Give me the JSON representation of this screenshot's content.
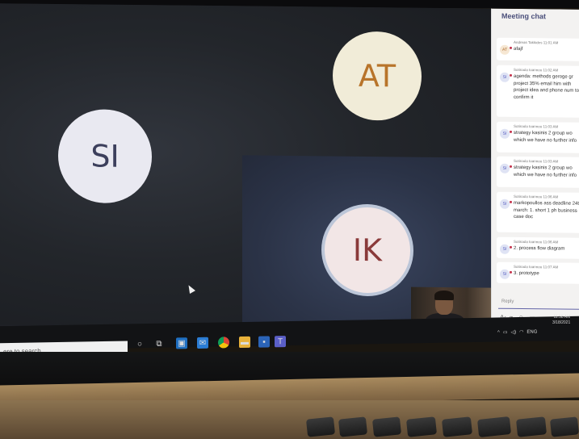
{
  "meeting": {
    "participants": [
      {
        "initials": "SI"
      },
      {
        "initials": "AT"
      },
      {
        "initials": "IK"
      }
    ]
  },
  "chat": {
    "title": "Meeting chat",
    "reply_placeholder": "Reply",
    "messages": [
      {
        "avatar": "AT",
        "sender": "Andreas Takkides",
        "time": "11:01 AM",
        "text": "afajf"
      },
      {
        "avatar": "SI",
        "sender": "Sotiroula Ioannou",
        "time": "11:02 AM",
        "text": "agenda: methods geroge gr project 35% email him with project idea and phone num to confirm it"
      },
      {
        "avatar": "SI",
        "sender": "Sotiroula Ioannou",
        "time": "11:03 AM",
        "text": "strategy kasinis 2 group wo which we have no further info"
      },
      {
        "avatar": "SI",
        "sender": "Sotiroula Ioannou",
        "time": "11:03 AM",
        "text": "strategy kasinis 2 group wo which we have no further info"
      },
      {
        "avatar": "SI",
        "sender": "Sotiroula Ioannou",
        "time": "11:06 AM",
        "text": "markopoullos ass deadline 24t march: 1. short 1 ph business case doc"
      },
      {
        "avatar": "SI",
        "sender": "Sotiroula Ioannou",
        "time": "11:06 AM",
        "text": "2. process flow diagram"
      },
      {
        "avatar": "SI",
        "sender": "Sotiroula Ioannou",
        "time": "11:07 AM",
        "text": "3. prototype"
      }
    ],
    "compose_icons": [
      "format-icon",
      "attach-icon",
      "emoji-icon",
      "gif-icon",
      "more-icon"
    ]
  },
  "taskbar": {
    "search_placeholder": "ere to search",
    "tray_lang": "ENG",
    "clock_time": "11:58 AM",
    "clock_date": "3/18/2021"
  },
  "colors": {
    "chat_accent": "#6264a7",
    "unread_dot": "#c4314b"
  }
}
